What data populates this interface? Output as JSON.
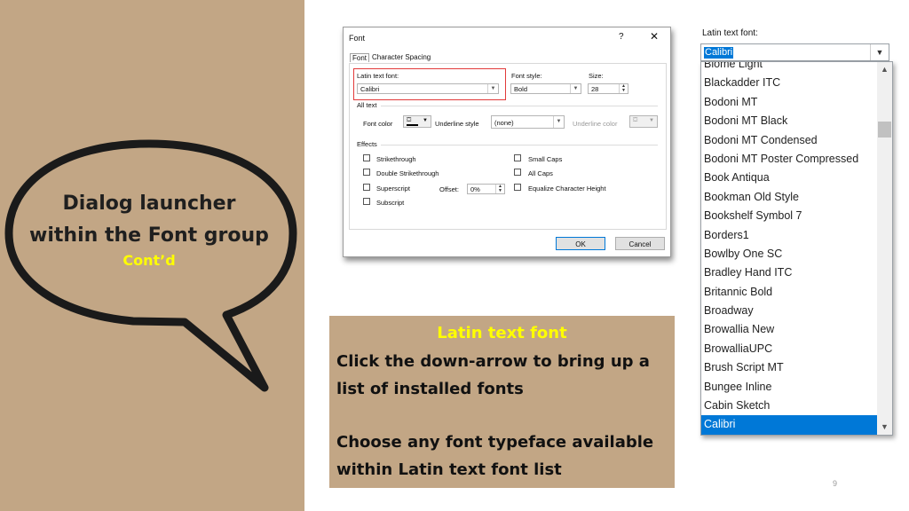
{
  "bubble": {
    "title_line1": "Dialog launcher",
    "title_line2": "within the Font group",
    "subtitle": "Cont’d"
  },
  "dialog": {
    "title": "Font",
    "help": "?",
    "close": "✕",
    "tabs": [
      "Font",
      "Character Spacing"
    ],
    "latin_label": "Latin text font:",
    "latin_value": "Calibri",
    "style_label": "Font style:",
    "style_value": "Bold",
    "size_label": "Size:",
    "size_value": "28",
    "all_text_label": "All text",
    "font_color_label": "Font color",
    "underline_style_label": "Underline style",
    "underline_style_value": "(none)",
    "underline_color_label": "Underline color",
    "effects_label": "Effects",
    "effects_left": [
      "Strikethrough",
      "Double Strikethrough",
      "Superscript",
      "Subscript"
    ],
    "effects_right": [
      "Small Caps",
      "All Caps",
      "Equalize Character Height"
    ],
    "offset_label": "Offset:",
    "offset_value": "0%",
    "ok_label": "OK",
    "cancel_label": "Cancel"
  },
  "caption": {
    "heading": "Latin text font",
    "para1": "Click the down-arrow to bring up a list of installed fonts",
    "para2": "Choose any font typeface available within Latin text font list"
  },
  "font_list": {
    "label": "Latin text font:",
    "value": "Calibri",
    "items": [
      "Blome Light",
      "Blackadder ITC",
      "Bodoni MT",
      "Bodoni MT Black",
      "Bodoni MT Condensed",
      "Bodoni MT Poster Compressed",
      "Book Antiqua",
      "Bookman Old Style",
      "Bookshelf Symbol 7",
      "Borders1",
      "Bowlby One SC",
      "Bradley Hand ITC",
      "Britannic Bold",
      "Broadway",
      "Browallia New",
      "BrowalliaUPC",
      "Brush Script MT",
      "Bungee Inline",
      "Cabin Sketch",
      "Calibri"
    ],
    "selected": "Calibri"
  },
  "page_number": "9",
  "colors": {
    "panel": "#c2a685",
    "highlight_text": "#ffff00",
    "selection": "#0078d7",
    "redbox": "#e23a3a"
  }
}
